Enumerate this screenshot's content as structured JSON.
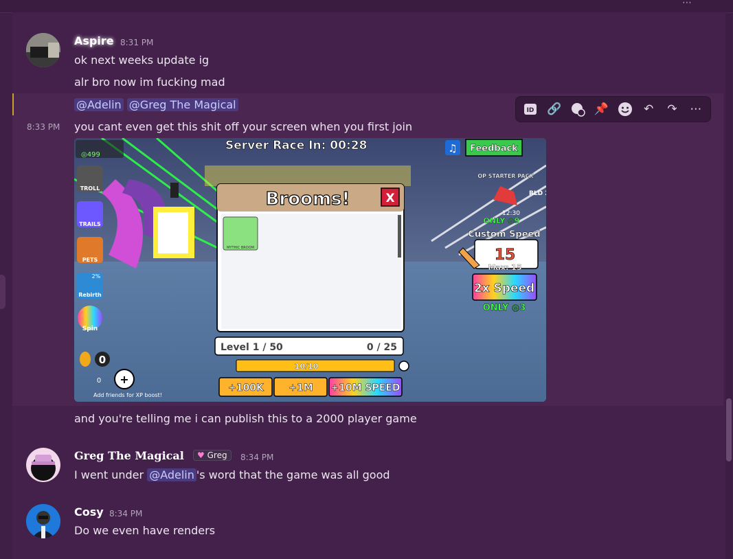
{
  "messages": [
    {
      "author": "Aspire",
      "time": "8:31 PM",
      "lines": [
        "ok next weeks update ig",
        "alr bro now im fucking mad"
      ]
    },
    {
      "mentions": [
        "@Adelin",
        "@Greg The Magical"
      ],
      "time": "8:33 PM",
      "text": "you cant even get this shit off your screen when you first join",
      "after_text": "and you're telling me i can publish this to a 2000 player game"
    },
    {
      "author": "Greg The Magical",
      "badge": "Greg",
      "time": "8:34 PM",
      "text_before": "I went under ",
      "mention": "@Adelin",
      "text_after": "'s word that the game was all good"
    },
    {
      "author": "Cosy",
      "time": "8:34 PM",
      "text": "Do we even have renders"
    }
  ],
  "toolbar": {
    "icons": [
      "id-icon",
      "link-icon",
      "thread-icon",
      "pin-icon",
      "emoji-icon",
      "reply-icon",
      "forward-icon",
      "more-icon"
    ]
  },
  "game_screenshot": {
    "timer": "Server Race In: 00:28",
    "feedback": "Feedback",
    "brooms_title": "Brooms!",
    "close": "X",
    "item_label": "MYTHIC BROOM",
    "level": "Level 1 / 50",
    "progress": "0 / 25",
    "bar_value": "10/10",
    "btn_100k": "+100K",
    "btn_1m": "+1M",
    "btn_speed": "+10M SPEED",
    "custom_speed": "Custom Speed",
    "speed_value": "15",
    "max_value": "Max: 15",
    "x2_speed": "2x Speed",
    "only_3": "ONLY ◎3",
    "op_starter": "OP STARTER PACK",
    "only_9": "ONLY ◎9",
    "timer_small": "12:30",
    "rld2": "RLD 2",
    "coins_top": "◎499",
    "egg_count": "0",
    "trophy_count": "0",
    "add_friends": "Add friends for XP boost!",
    "side_troll": "TROLL",
    "side_trails": "TRAILS",
    "side_pets": "PETS",
    "side_rebirth": "Rebirth",
    "side_rebirth_pct": "2%",
    "side_spin": "Spin"
  }
}
